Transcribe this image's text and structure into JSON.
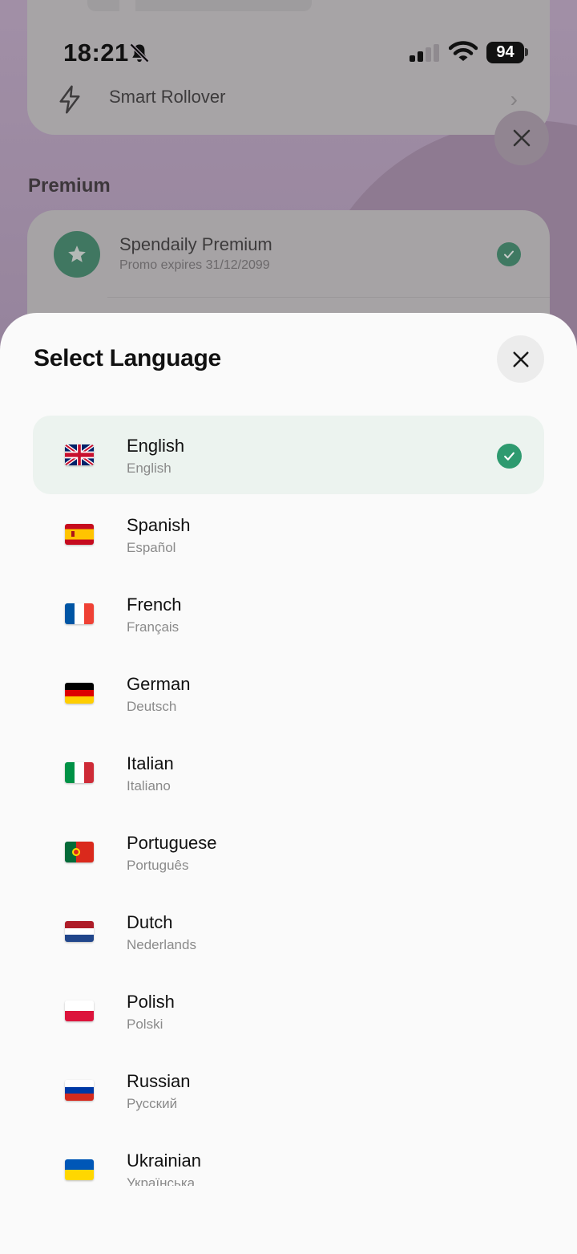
{
  "status_bar": {
    "time": "18:21",
    "battery": "94",
    "icons": [
      "bell-slash-icon",
      "signal-icon",
      "wifi-icon",
      "battery-icon"
    ]
  },
  "background": {
    "row_label": "Smart Rollover",
    "section_title": "Premium",
    "premium": {
      "title": "Spendaily Premium",
      "subtitle": "Promo expires 31/12/2099"
    }
  },
  "sheet": {
    "title": "Select Language",
    "selected": "English",
    "languages": [
      {
        "name": "English",
        "native": "English",
        "flag": "uk"
      },
      {
        "name": "Spanish",
        "native": "Español",
        "flag": "es"
      },
      {
        "name": "French",
        "native": "Français",
        "flag": "fr"
      },
      {
        "name": "German",
        "native": "Deutsch",
        "flag": "de"
      },
      {
        "name": "Italian",
        "native": "Italiano",
        "flag": "it"
      },
      {
        "name": "Portuguese",
        "native": "Português",
        "flag": "pt"
      },
      {
        "name": "Dutch",
        "native": "Nederlands",
        "flag": "nl"
      },
      {
        "name": "Polish",
        "native": "Polski",
        "flag": "pl"
      },
      {
        "name": "Russian",
        "native": "Русский",
        "flag": "ru"
      },
      {
        "name": "Ukrainian",
        "native": "Українська",
        "flag": "ua"
      }
    ]
  },
  "colors": {
    "accent": "#2e9a6f",
    "selected_bg": "#ecf3ef",
    "premium_icon": "#2f7a5c"
  }
}
